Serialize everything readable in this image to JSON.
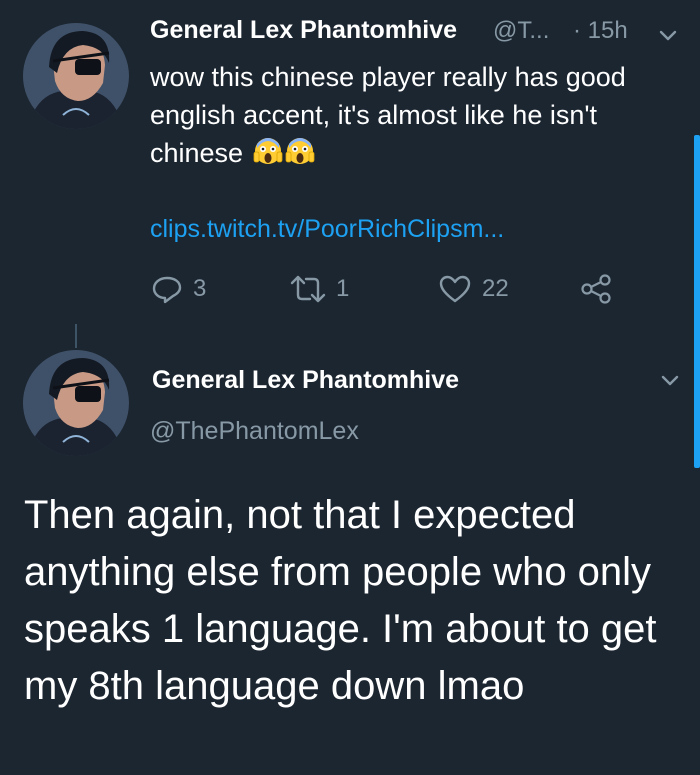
{
  "tweet1": {
    "display_name": "General Lex Phantomhive",
    "handle_truncated": "@T...",
    "time": "· 15h",
    "text": "wow this chinese player really has good english accent, it's almost like he isn't chinese",
    "emoji": "😱😱",
    "link": "clips.twitch.tv/PoorRichClipsm...",
    "reply_count": "3",
    "retweet_count": "1",
    "like_count": "22"
  },
  "tweet2": {
    "display_name": "General Lex Phantomhive",
    "handle": "@ThePhantomLex",
    "text": "Then again, not that I expected anything else from people who only speaks 1 language. I'm about to get my 8th language down lmao"
  },
  "colors": {
    "background": "#1c2631",
    "accent": "#1da1f2",
    "secondary_text": "#8899a6"
  }
}
